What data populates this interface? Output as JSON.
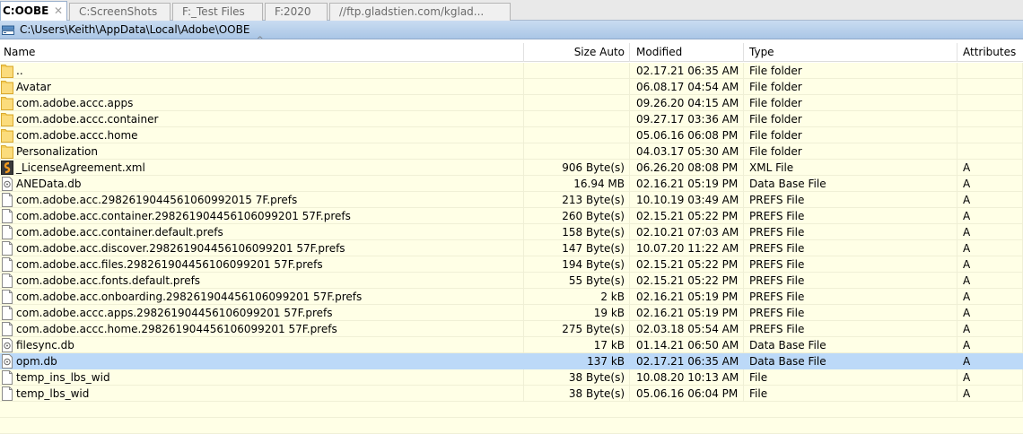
{
  "tabs": [
    {
      "label": "C:OOBE",
      "close": "✕",
      "active": true
    },
    {
      "label": "C:ScreenShots",
      "active": false
    },
    {
      "label": "F:_Test Files",
      "active": false
    },
    {
      "label": "F:2020",
      "active": false
    },
    {
      "label": "//ftp.gladstien.com/kglad...",
      "active": false
    }
  ],
  "path": "C:\\Users\\Keith\\AppData\\Local\\Adobe\\OOBE",
  "sort_indicator": "^",
  "columns": {
    "name": "Name",
    "size": "Size Auto",
    "modified": "Modified",
    "type": "Type",
    "attributes": "Attributes"
  },
  "files": [
    {
      "name": "..",
      "size": "",
      "modified": "02.17.21 06:35 AM",
      "type": "File folder",
      "attr": "",
      "icon": "folder-icon"
    },
    {
      "name": "Avatar",
      "size": "",
      "modified": "06.08.17 04:54 AM",
      "type": "File folder",
      "attr": "",
      "icon": "folder-icon"
    },
    {
      "name": "com.adobe.accc.apps",
      "size": "",
      "modified": "09.26.20 04:15 AM",
      "type": "File folder",
      "attr": "",
      "icon": "folder-icon"
    },
    {
      "name": "com.adobe.accc.container",
      "size": "",
      "modified": "09.27.17 03:36 AM",
      "type": "File folder",
      "attr": "",
      "icon": "folder-icon"
    },
    {
      "name": "com.adobe.accc.home",
      "size": "",
      "modified": "05.06.16 06:08 PM",
      "type": "File folder",
      "attr": "",
      "icon": "folder-icon"
    },
    {
      "name": "Personalization",
      "size": "",
      "modified": "04.03.17 05:30 AM",
      "type": "File folder",
      "attr": "",
      "icon": "folder-icon"
    },
    {
      "name": "_LicenseAgreement.xml",
      "size": "906 Byte(s)",
      "modified": "06.26.20 08:08 PM",
      "type": "XML File",
      "attr": "A",
      "icon": "xml-file-icon"
    },
    {
      "name": "ANEData.db",
      "size": "16.94 MB",
      "modified": "02.16.21 05:19 PM",
      "type": "Data Base File",
      "attr": "A",
      "icon": "database-file-icon"
    },
    {
      "name": "com.adobe.acc.2982619044561060992015 7F.prefs",
      "size": "213 Byte(s)",
      "modified": "10.10.19 03:49 AM",
      "type": "PREFS File",
      "attr": "A",
      "icon": "document-file-icon"
    },
    {
      "name": "com.adobe.acc.container.298261904456106099201 57F.prefs",
      "size": "260 Byte(s)",
      "modified": "02.15.21 05:22 PM",
      "type": "PREFS File",
      "attr": "A",
      "icon": "document-file-icon"
    },
    {
      "name": "com.adobe.acc.container.default.prefs",
      "size": "158 Byte(s)",
      "modified": "02.10.21 07:03 AM",
      "type": "PREFS File",
      "attr": "A",
      "icon": "document-file-icon"
    },
    {
      "name": "com.adobe.acc.discover.298261904456106099201 57F.prefs",
      "size": "147 Byte(s)",
      "modified": "10.07.20 11:22 AM",
      "type": "PREFS File",
      "attr": "A",
      "icon": "document-file-icon"
    },
    {
      "name": "com.adobe.acc.files.298261904456106099201 57F.prefs",
      "size": "194 Byte(s)",
      "modified": "02.15.21 05:22 PM",
      "type": "PREFS File",
      "attr": "A",
      "icon": "document-file-icon"
    },
    {
      "name": "com.adobe.acc.fonts.default.prefs",
      "size": "55 Byte(s)",
      "modified": "02.15.21 05:22 PM",
      "type": "PREFS File",
      "attr": "A",
      "icon": "document-file-icon"
    },
    {
      "name": "com.adobe.acc.onboarding.298261904456106099201 57F.prefs",
      "size": "2 kB",
      "modified": "02.16.21 05:19 PM",
      "type": "PREFS File",
      "attr": "A",
      "icon": "document-file-icon"
    },
    {
      "name": "com.adobe.accc.apps.298261904456106099201 57F.prefs",
      "size": "19 kB",
      "modified": "02.16.21 05:19 PM",
      "type": "PREFS File",
      "attr": "A",
      "icon": "document-file-icon"
    },
    {
      "name": "com.adobe.accc.home.298261904456106099201 57F.prefs",
      "size": "275 Byte(s)",
      "modified": "02.03.18 05:54 AM",
      "type": "PREFS File",
      "attr": "A",
      "icon": "document-file-icon"
    },
    {
      "name": "filesync.db",
      "size": "17 kB",
      "modified": "01.14.21 06:50 AM",
      "type": "Data Base File",
      "attr": "A",
      "icon": "database-file-icon"
    },
    {
      "name": "opm.db",
      "size": "137 kB",
      "modified": "02.17.21 06:35 AM",
      "type": "Data Base File",
      "attr": "A",
      "icon": "database-file-icon",
      "selected": true
    },
    {
      "name": "temp_ins_lbs_wid",
      "size": "38 Byte(s)",
      "modified": "10.08.20 10:13 AM",
      "type": "File",
      "attr": "A",
      "icon": "document-file-icon"
    },
    {
      "name": "temp_lbs_wid",
      "size": "38 Byte(s)",
      "modified": "05.06.16 06:04 PM",
      "type": "File",
      "attr": "A",
      "icon": "document-file-icon"
    }
  ],
  "colors": {
    "row_background": "#ffffe6",
    "selected_row": "#bcd9f8",
    "path_bar": "#b9d1ec",
    "folder": "#f6cf5a"
  }
}
